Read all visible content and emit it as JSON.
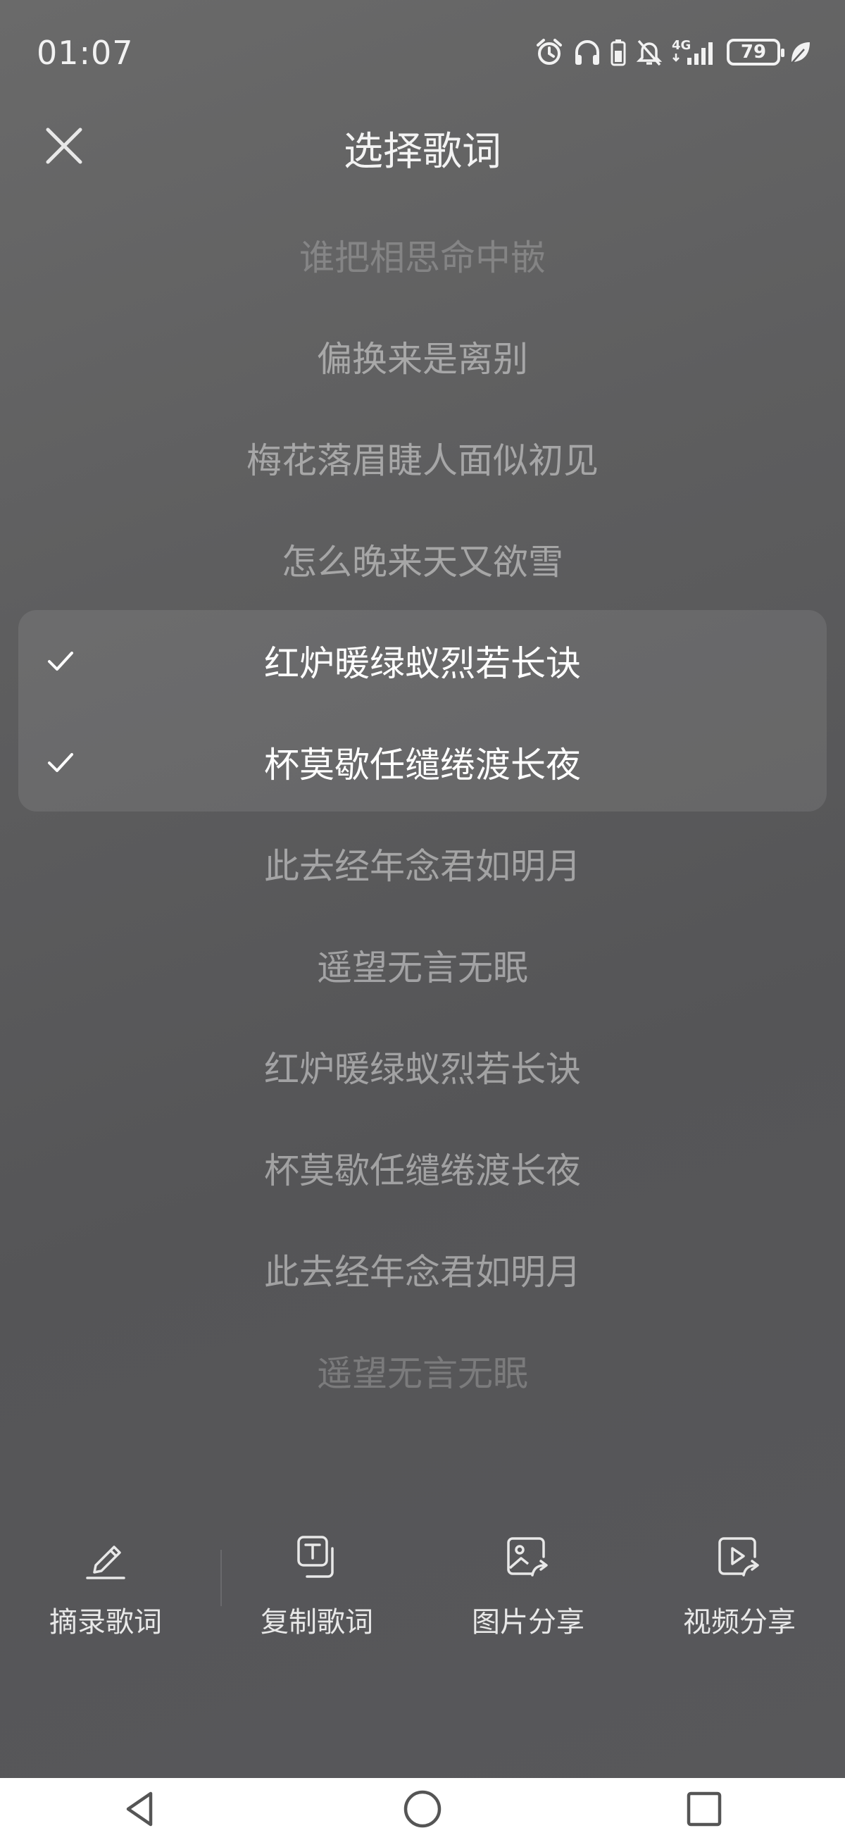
{
  "status_bar": {
    "time": "01:07",
    "battery_level": "79",
    "icons": [
      "alarm-icon",
      "headphones-icon",
      "battery-saver-icon",
      "mute-icon",
      "4g-signal-icon",
      "battery-icon",
      "leaf-icon"
    ],
    "network": "4G"
  },
  "header": {
    "title": "选择歌词",
    "close_icon": "close-icon"
  },
  "lyrics": [
    {
      "text": "谁把相思命中嵌",
      "selected": false
    },
    {
      "text": "偏换来是离别",
      "selected": false
    },
    {
      "text": "梅花落眉睫人面似初见",
      "selected": false
    },
    {
      "text": "怎么晚来天又欲雪",
      "selected": false
    },
    {
      "text": "红炉暖绿蚁烈若长诀",
      "selected": true
    },
    {
      "text": "杯莫歇任缱绻渡长夜",
      "selected": true
    },
    {
      "text": "此去经年念君如明月",
      "selected": false
    },
    {
      "text": "遥望无言无眠",
      "selected": false
    },
    {
      "text": "红炉暖绿蚁烈若长诀",
      "selected": false
    },
    {
      "text": "杯莫歇任缱绻渡长夜",
      "selected": false
    },
    {
      "text": "此去经年念君如明月",
      "selected": false
    },
    {
      "text": "遥望无言无眠",
      "selected": false
    }
  ],
  "actions": [
    {
      "label": "摘录歌词",
      "icon": "pencil-icon"
    },
    {
      "label": "复制歌词",
      "icon": "copy-text-icon"
    },
    {
      "label": "图片分享",
      "icon": "image-share-icon"
    },
    {
      "label": "视频分享",
      "icon": "video-share-icon"
    }
  ],
  "colors": {
    "accent": "#ffffff",
    "background": "#5e5e5f",
    "nav_bar": "#ffffff"
  }
}
